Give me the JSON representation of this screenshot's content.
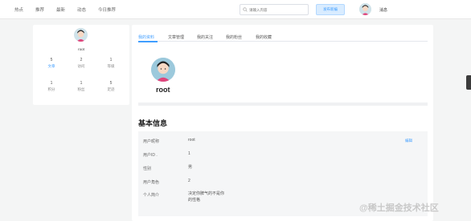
{
  "nav": {
    "items": [
      "热点",
      "推荐",
      "最新",
      "动态",
      "今日推荐"
    ],
    "search_placeholder": "请输入内容",
    "publish_label": "发布新编",
    "messages_label": "消息"
  },
  "left_card": {
    "username": "root",
    "stats": [
      {
        "value": "5",
        "label": "文章"
      },
      {
        "value": "2",
        "label": "访问"
      },
      {
        "value": "1",
        "label": "等级"
      },
      {
        "value": "1",
        "label": "积分"
      },
      {
        "value": "1",
        "label": "粉丝"
      },
      {
        "value": "5",
        "label": "足迹"
      }
    ]
  },
  "main": {
    "tabs": [
      "我的资料",
      "文章管理",
      "我的关注",
      "我的粉丝",
      "我的收藏"
    ],
    "profile_name": "root",
    "section_title": "基本信息",
    "edit_label": "编辑",
    "info": [
      {
        "label": "用户昵称",
        "value": "root"
      },
      {
        "label": "用户ID .",
        "value": "1"
      },
      {
        "label": "性别",
        "value": "男"
      },
      {
        "label": "用户角色",
        "value": "2"
      },
      {
        "label": "个人简介",
        "value": "决定你脾气的不是你",
        "value2": "的性格"
      }
    ]
  },
  "watermark": "@稀土掘金技术社区",
  "colors": {
    "accent": "#409eff",
    "background": "#f4f5f5"
  }
}
